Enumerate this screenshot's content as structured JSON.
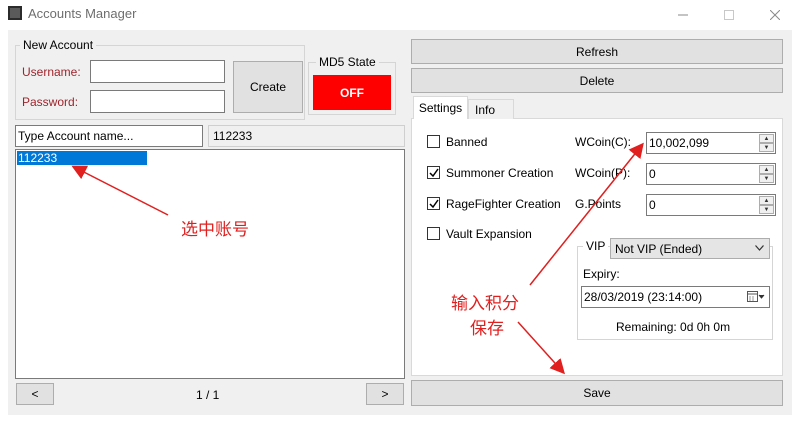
{
  "window": {
    "title": "Accounts Manager"
  },
  "new_account": {
    "group_label": "New Account",
    "username_label": "Username:",
    "password_label": "Password:",
    "username_value": "",
    "password_value": "",
    "create_label": "Create"
  },
  "md5": {
    "group_label": "MD5 State",
    "state": "OFF",
    "state_color": "#ff0000"
  },
  "search": {
    "placeholder": "Type Account name...",
    "selected_value": "112233"
  },
  "accounts": {
    "items": [
      "112233"
    ],
    "selected": "112233"
  },
  "pager": {
    "prev": "<",
    "next": ">",
    "page": "1 / 1"
  },
  "actions": {
    "refresh": "Refresh",
    "delete": "Delete",
    "save": "Save"
  },
  "tabs": [
    {
      "label": "Settings",
      "active": true
    },
    {
      "label": "Info",
      "active": false
    }
  ],
  "settings": {
    "checkboxes": [
      {
        "label": "Banned",
        "checked": false
      },
      {
        "label": "Summoner Creation",
        "checked": true
      },
      {
        "label": "RageFighter Creation",
        "checked": true
      },
      {
        "label": "Vault Expansion",
        "checked": false
      }
    ],
    "wcoin_c_label": "WCoin(C):",
    "wcoin_c_value": "10,002,099",
    "wcoin_p_label": "WCoin(P):",
    "wcoin_p_value": "0",
    "gpoints_label": "G.Points",
    "gpoints_value": "0",
    "vip": {
      "group_label": "VIP",
      "selected": "Not VIP (Ended)",
      "expiry_label": "Expiry:",
      "expiry_value": "28/03/2019 (23:14:00)",
      "remaining": "Remaining: 0d 0h 0m"
    }
  },
  "annotations": {
    "select_account": "选中账号",
    "enter_points": "输入积分",
    "save": "保存",
    "color": "#e01f1f"
  },
  "colors": {
    "selection": "#0078d7",
    "button_face": "#e1e1e1"
  }
}
